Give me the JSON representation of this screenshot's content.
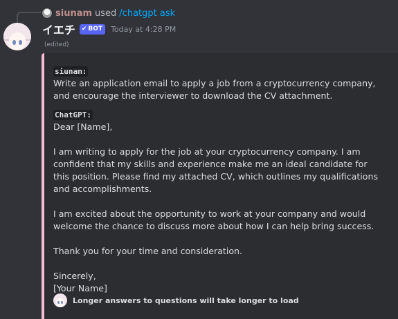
{
  "reply": {
    "username": "siunam",
    "used_text": "used",
    "command": "/chatgpt ask"
  },
  "message": {
    "author": "イエチ",
    "bot_tag": "BOT",
    "bot_check": "✔",
    "timestamp": "Today at 4:28 PM",
    "edited": "(edited)"
  },
  "embed": {
    "accent_color": "#f5bcd3",
    "user_label": "siunam:",
    "user_prompt": "Write an application email to apply a job from a cryptocurrency company, and encourage the interviewer to download the CV attachment.",
    "bot_label": "ChatGPT:",
    "response": {
      "greeting": "Dear [Name],",
      "p1": "I am writing to apply for the job at your cryptocurrency company. I am confident that my skills and experience make me an ideal candidate for this position. Please find my attached CV, which outlines my qualifications and accomplishments.",
      "p2": "I am excited about the opportunity to work at your company and would welcome the chance to discuss more about how I can help bring success.",
      "p3": "Thank you for your time and consideration.",
      "closing": "Sincerely,",
      "signature": "[Your Name]"
    },
    "footer": "Longer answers to questions will take longer to load"
  },
  "colors": {
    "background": "#313338",
    "embed_background": "#2b2d31",
    "bot_tag": "#5865f2",
    "command_link": "#00a8fc",
    "reply_username": "#c08f8f"
  }
}
